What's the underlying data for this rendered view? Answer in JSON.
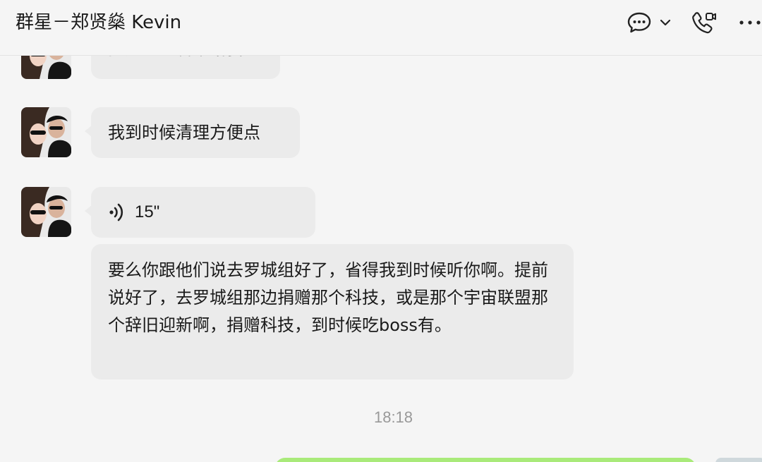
{
  "header": {
    "title": "群星－郑贤燊 Kevin",
    "icons": [
      "chat-bubble-icon",
      "chevron-down-icon",
      "phone-video-icon",
      "more-icon"
    ]
  },
  "messages": [
    {
      "type": "text",
      "text": "把这些人名单给我",
      "partial": true
    },
    {
      "type": "text",
      "text": "我到时候清理方便点"
    },
    {
      "type": "voice",
      "icon": "voice-wave-icon",
      "duration": "15\""
    },
    {
      "type": "text",
      "text": "要么你跟他们说去罗城组好了，省得我到时候听你啊。提前说好了，去罗城组那边捐赠那个科技，或是那个宇宙联盟那个辞旧迎新啊，捐赠科技，到时候吃boss有。"
    }
  ],
  "timestamp": "18:18",
  "colors": {
    "background": "#f5f5f5",
    "bubble_received": "#ebebeb",
    "bubble_sent": "#a9ea7a",
    "timestamp": "#999999"
  }
}
